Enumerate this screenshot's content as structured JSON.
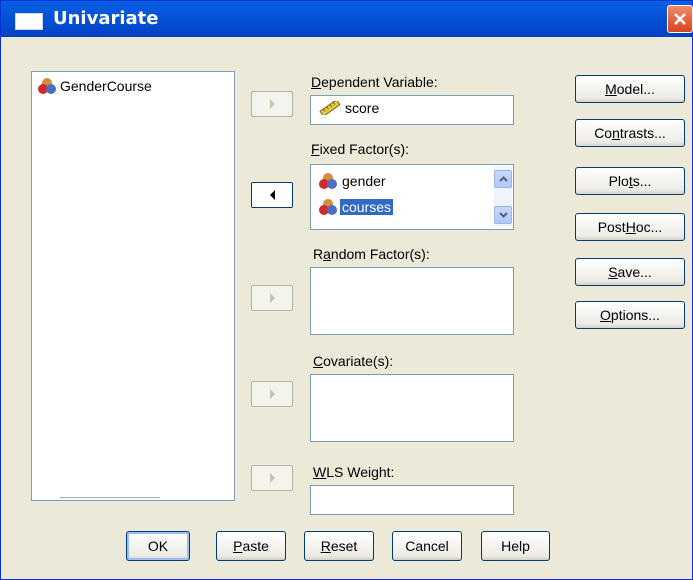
{
  "window": {
    "title": "Univariate",
    "icons": {
      "title": "window-icon",
      "close": "close-icon"
    }
  },
  "variable_list": {
    "items": [
      {
        "label": "GenderCourse",
        "icon": "nominal-variable-icon"
      }
    ]
  },
  "dependent_variable": {
    "label_u": "D",
    "label_rest": "ependent Variable:",
    "value": "score",
    "icon": "scale-variable-icon"
  },
  "fixed_factors": {
    "label_u": "F",
    "label_rest": "ixed Factor(s):",
    "items": [
      {
        "label": "gender",
        "selected": false,
        "icon": "nominal-variable-icon"
      },
      {
        "label": "courses",
        "selected": true,
        "icon": "nominal-variable-icon"
      }
    ]
  },
  "random_factors": {
    "label_pre": "R",
    "label_u": "a",
    "label_rest": "ndom Factor(s):"
  },
  "covariates": {
    "label_u": "C",
    "label_rest": "ovariate(s):"
  },
  "wls_weight": {
    "label_u": "W",
    "label_rest": "LS Weight:"
  },
  "side_buttons": [
    {
      "pre": "",
      "u": "M",
      "post": "odel..."
    },
    {
      "pre": "Co",
      "u": "n",
      "post": "trasts..."
    },
    {
      "pre": "Plo",
      "u": "t",
      "post": "s..."
    },
    {
      "pre": "Post ",
      "u": "H",
      "post": "oc..."
    },
    {
      "pre": "",
      "u": "S",
      "post": "ave..."
    },
    {
      "pre": "",
      "u": "O",
      "post": "ptions..."
    }
  ],
  "bottom_buttons": [
    {
      "pre": "OK",
      "u": "",
      "post": ""
    },
    {
      "pre": "",
      "u": "P",
      "post": "aste"
    },
    {
      "pre": "",
      "u": "R",
      "post": "eset"
    },
    {
      "pre": "Cancel",
      "u": "",
      "post": ""
    },
    {
      "pre": "Help",
      "u": "",
      "post": ""
    }
  ],
  "colors": {
    "titlebar": "#0554d9",
    "selection": "#316ac5",
    "dialog_bg": "#ece9d8"
  }
}
